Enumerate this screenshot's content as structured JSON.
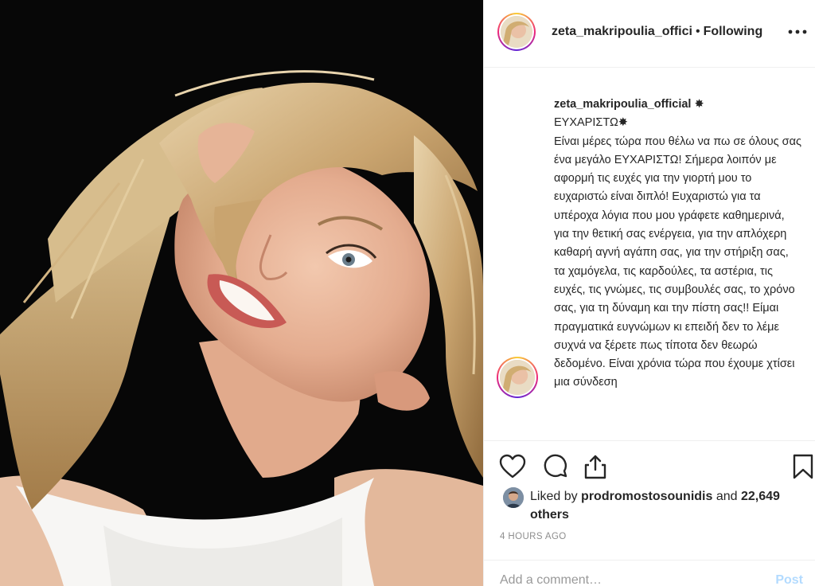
{
  "post": {
    "username": "zeta_makripoulia_offici",
    "separator": "•",
    "follow_status": "Following",
    "more_icon": "more-horizontal-icon"
  },
  "caption": {
    "username": "zeta_makripoulia_official",
    "text": "Είναι μέρες τώρα που θέλω να πω σε όλους σας ένα μεγάλο ΕΥΧΑΡΙΣΤΩ! Σήμερα λοιπόν με αφορμή τις ευχές για την γιορτή μου το ευχαριστώ είναι διπλό! Ευχαριστώ για τα υπέροχα λόγια που μου γράφετε καθημερινά, για την θετική σας ενέργεια, για την απλόχερη καθαρή αγνή αγάπη σας, για την στήριξη σας, τα χαμόγελα, τις καρδούλες, τα αστέρια, τις ευχές, τις γνώμες, τις συμβουλές σας, το χρόνο σας, για τη δύναμη και την πίστη σας!! Είμαι πραγματικά ευγνώμων κι επειδή δεν το λέμε συχνά να ξέρετε πως τίποτα δεν θεωρώ δεδομένο. Είναι χρόνια τώρα που έχουμε χτίσει μια σύνδεση",
    "first_line": "ΕΥΧΑΡΙΣΤΩ"
  },
  "likes": {
    "prefix": "Liked by",
    "user": "prodromostosounidis",
    "conj": "and",
    "count": "22,649 others"
  },
  "time_ago": "4 HOURS AGO",
  "comment": {
    "placeholder": "Add a comment…",
    "post_label": "Post"
  },
  "colors": {
    "text": "#262626",
    "muted": "#8e8e8e",
    "post_disabled": "#b3dbff",
    "divider": "#efefef"
  }
}
